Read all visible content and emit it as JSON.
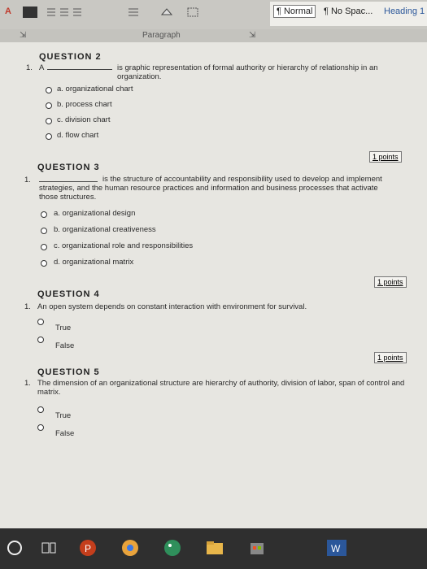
{
  "ribbon": {
    "font_color_label": "A",
    "styles": [
      "¶ Normal",
      "¶ No Spac...",
      "Heading 1"
    ],
    "group_label": "Paragraph"
  },
  "questions": [
    {
      "heading": "QUESTION 2",
      "number": "1.",
      "prefix": "A",
      "text": "is graphic representation of formal authority or hierarchy of relationship in an organization.",
      "options": [
        "a. organizational chart",
        "b. process chart",
        "c. division chart",
        "d. flow chart"
      ],
      "points": "1 points"
    },
    {
      "heading": "QUESTION 3",
      "number": "1.",
      "text": "is the structure of accountability and responsibility used to develop and implement strategies, and the human resource practices and information and business processes that activate those structures.",
      "options": [
        "a. organizational design",
        "b. organizational creativeness",
        "c. organizational role and responsibilities",
        "d. organizational matrix"
      ],
      "points": "1 points"
    },
    {
      "heading": "QUESTION 4",
      "number": "1.",
      "text": "An open system depends on constant interaction with environment for survival.",
      "options": [
        "True",
        "False"
      ],
      "points": "1 points"
    },
    {
      "heading": "QUESTION 5",
      "number": "1.",
      "text": "The dimension of an organizational structure are hierarchy of authority, division of labor, span of control and matrix.",
      "options": [
        "True",
        "False"
      ]
    }
  ],
  "taskbar": {
    "icons": [
      "cortana-icon",
      "task-view-icon",
      "powerpoint-icon",
      "chrome-icon",
      "paint-icon",
      "file-explorer-icon",
      "store-icon",
      "word-icon"
    ]
  },
  "colors": {
    "ribbon": "#c9c8c3",
    "page": "#e7e6e1",
    "taskbar": "#2f2f2f",
    "word": "#2b579a"
  }
}
